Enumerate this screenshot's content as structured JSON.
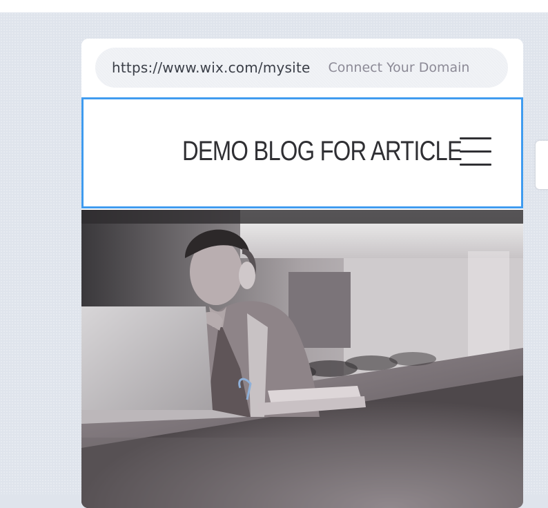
{
  "browser": {
    "url": "https://www.wix.com/mysite",
    "connect_domain_label": "Connect Your Domain"
  },
  "site_header": {
    "title": "DEMO BLOG FOR ARTICLE",
    "menu_icon": "hamburger-menu-icon"
  },
  "hero": {
    "image_description": "student with headphones at laptop in library"
  },
  "colors": {
    "selection_border": "#3f9bef",
    "canvas_background": "#dfe4ec",
    "url_text": "#3b3f48",
    "connect_domain_text": "#8c8a96"
  }
}
